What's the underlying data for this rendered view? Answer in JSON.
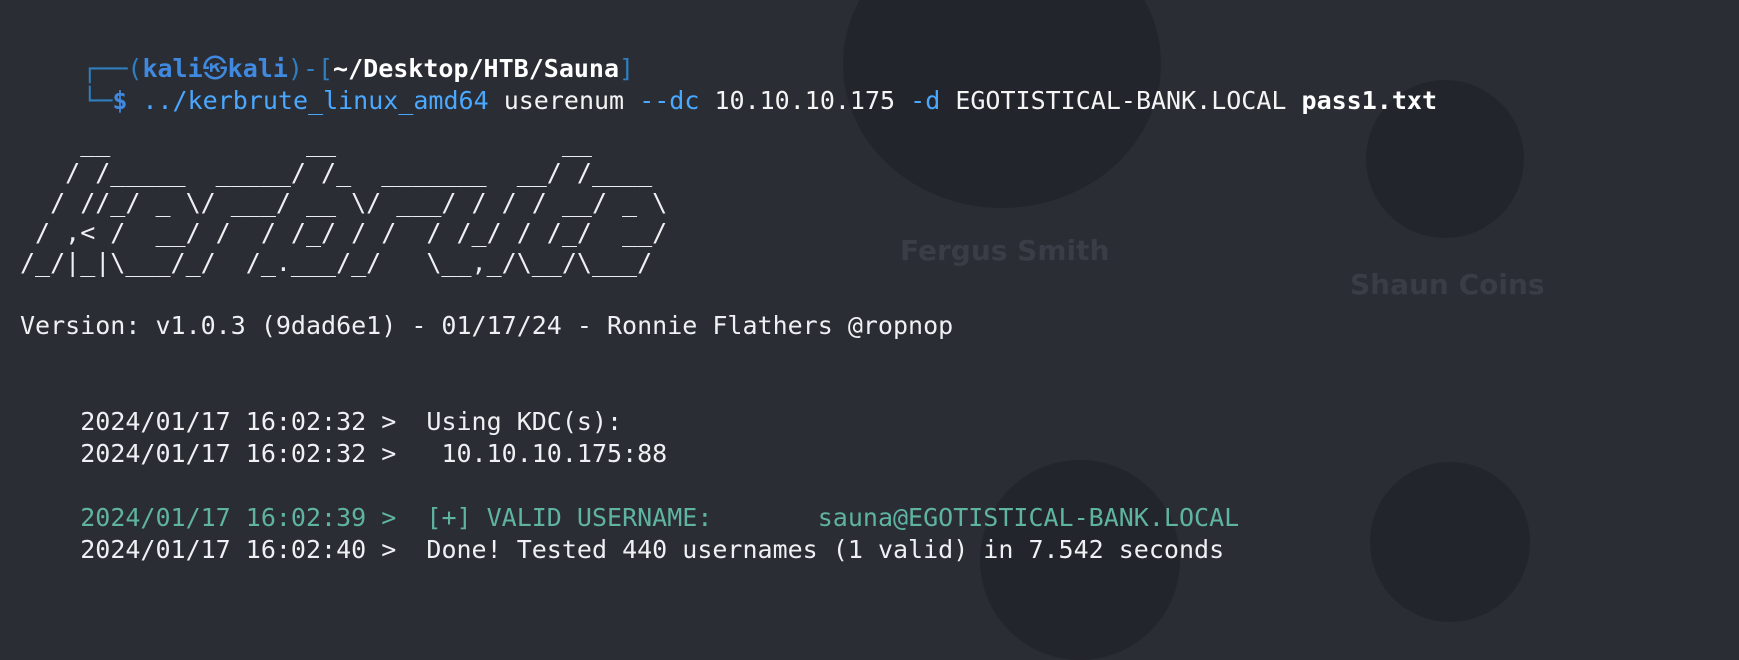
{
  "background": {
    "person_names": [
      "Fergus Smith",
      "Shaun Coins"
    ]
  },
  "prompt": {
    "frame_top": "┌──(",
    "user": "kali",
    "skull_icon": "㉿",
    "host": "kali",
    "sep": ")-[",
    "cwd": "~/Desktop/HTB/Sauna",
    "close": "]",
    "frame_bottom": "└─",
    "symbol": "$"
  },
  "command": {
    "binary": "../kerbrute_linux_amd64",
    "subcommand": "userenum",
    "flag_dc": "--dc",
    "dc_value": "10.10.10.175",
    "flag_d": "-d",
    "domain": "EGOTISTICAL-BANK.LOCAL",
    "wordlist": "pass1.txt"
  },
  "banner": "    __             __               __\n   / /_____  _____/ /_  _______  __/ /____\n  / //_/ _ \\/ ___/ __ \\/ ___/ / / / __/ _ \\\n / ,< /  __/ /  / /_/ / /  / /_/ / /_/  __/\n/_/|_|\\___/_/  /_.___/_/   \\__,_/\\__/\\___/",
  "version_line": "Version: v1.0.3 (9dad6e1) - 01/17/24 - Ronnie Flathers @ropnop",
  "output": [
    {
      "ts": "2024/01/17 16:02:32 >",
      "msg": "  Using KDC(s):"
    },
    {
      "ts": "2024/01/17 16:02:32 >",
      "msg": "   10.10.10.175:88"
    }
  ],
  "result_valid": {
    "ts": "2024/01/17 16:02:39 >",
    "msg": "  [+] VALID USERNAME:       sauna@EGOTISTICAL-BANK.LOCAL"
  },
  "result_done": {
    "ts": "2024/01/17 16:02:40 >",
    "msg": "  Done! Tested 440 usernames (1 valid) in 7.542 seconds"
  },
  "colors": {
    "background": "#2b2d35",
    "prompt_blue": "#3f8ae0",
    "valid_green": "#5fb4a0"
  }
}
